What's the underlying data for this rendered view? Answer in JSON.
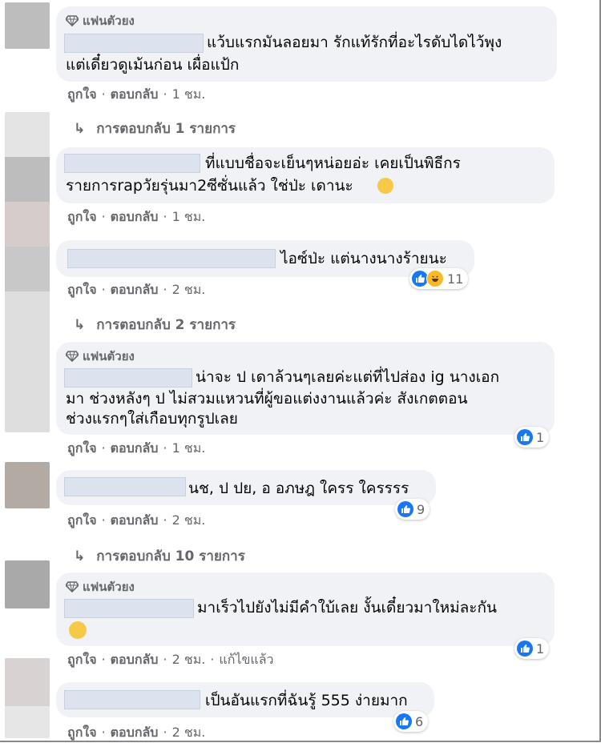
{
  "common": {
    "like": "ถูกใจ",
    "reply": "ตอบกลับ",
    "sep": "·"
  },
  "comments": [
    {
      "badge": "แฟนตัวยง",
      "line1": "แว้บแรกมันลอยมา รักแท้รักที่อะไรดับไดไว้พุง",
      "line2": "แต่เดี๋ยวดูเม้นก่อน เผื่อแป้ก",
      "time": "1 ชม."
    },
    {
      "line1": "ที่แบบชื่อจะเย็นๆหน่อยอ่ะ เคยเป็นพิธีกร",
      "line2": "รายการrapวัยรุ่นมา2ซีซั่นแล้ว ใช่ป่ะ เดานะ",
      "time": "1 ชม."
    },
    {
      "line1": "ไอซ์ป่ะ แต่นางนางร้ายนะ",
      "time": "2 ชม.",
      "reactions": "11"
    },
    {
      "badge": "แฟนตัวยง",
      "line1": "น่าจะ ป เดาล้วนๆเลยค่ะแต่ที่ไปส่อง ig นางเอก",
      "line2": "มา ช่วงหลังๆ ป ไม่สวมแหวนที่ผู้ขอแต่งงานแล้วค่ะ สังเกตตอน",
      "line3": "ช่วงแรกๆใส่เกือบทุกรูปเลย",
      "time": "1 ชม.",
      "reactions": "1"
    },
    {
      "line1": "นช, ป ปย, อ อภษฎ ใครร ใครรรร",
      "time": "2 ชม.",
      "reactions": "9"
    },
    {
      "badge": "แฟนตัวยง",
      "line1": "มาเร็วไปยังไม่มีคำใบ้เลย งั้นเดี๋ยวมาใหม่ละกัน",
      "time": "2 ชม.",
      "edited": "แก้ไขแล้ว",
      "reactions": "1"
    },
    {
      "line1": "เป็นอันแรกที่ฉันรู้ 555 ง่ายมาก",
      "time": "2 ชม.",
      "reactions": "6"
    }
  ],
  "replies": [
    "การตอบกลับ 1 รายการ",
    "การตอบกลับ 2 รายการ",
    "การตอบกลับ 10 รายการ"
  ]
}
